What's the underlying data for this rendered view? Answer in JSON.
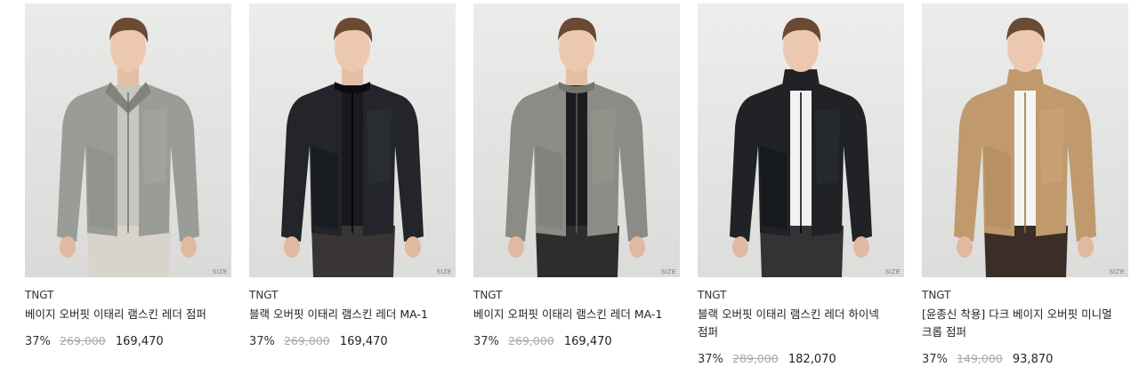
{
  "products": [
    {
      "size_tag": "SIZE",
      "brand": "TNGT",
      "name": "베이지 오버핏 이태리 램스킨 레더 점퍼",
      "discount": "37%",
      "original_price": "269,000",
      "sale_price": "169,470",
      "image": {
        "alt": "model wearing grey leather collar jacket",
        "bg": "#e4e4e2",
        "jacket": "#9a9d97",
        "inner": "#c9c6bf",
        "pants": "#d8d3cb",
        "style": "collar"
      }
    },
    {
      "size_tag": "SIZE",
      "brand": "TNGT",
      "name": "블랙 오버핏 이태리 램스킨 레더 MA-1",
      "discount": "37%",
      "original_price": "269,000",
      "sale_price": "169,470",
      "image": {
        "alt": "model wearing black leather bomber jacket",
        "bg": "#e6e6e5",
        "jacket": "#23252a",
        "inner": "#1a1a1c",
        "pants": "#3a3535",
        "style": "bomber"
      }
    },
    {
      "size_tag": "SIZE",
      "brand": "TNGT",
      "name": "베이지 오퍼핏 이태리 램스킨 레더 MA-1",
      "discount": "37%",
      "original_price": "269,000",
      "sale_price": "169,470",
      "image": {
        "alt": "model wearing grey leather bomber jacket",
        "bg": "#e5e5e3",
        "jacket": "#8a8c85",
        "inner": "#1c1c1e",
        "pants": "#2e2c2c",
        "style": "bomber"
      }
    },
    {
      "size_tag": "SIZE",
      "brand": "TNGT",
      "name": "블랙 오버핏 이태리 램스킨 레더 하이넥 점퍼",
      "discount": "37%",
      "original_price": "289,000",
      "sale_price": "182,070",
      "image": {
        "alt": "model wearing black leather high-neck jacket",
        "bg": "#e7e7e6",
        "jacket": "#202226",
        "inner": "#f2f2f2",
        "pants": "#333336",
        "style": "highneck"
      }
    },
    {
      "size_tag": "SIZE",
      "brand": "TNGT",
      "name": "[윤종신 착용] 다크 베이지 오버핏 미니멀 크롭 점퍼",
      "discount": "37%",
      "original_price": "149,000",
      "sale_price": "93,870",
      "image": {
        "alt": "model wearing dark beige cropped jacket",
        "bg": "#e6e6e4",
        "jacket": "#c09a6c",
        "inner": "#f4f4f2",
        "pants": "#3b2e28",
        "style": "highneck"
      }
    }
  ]
}
